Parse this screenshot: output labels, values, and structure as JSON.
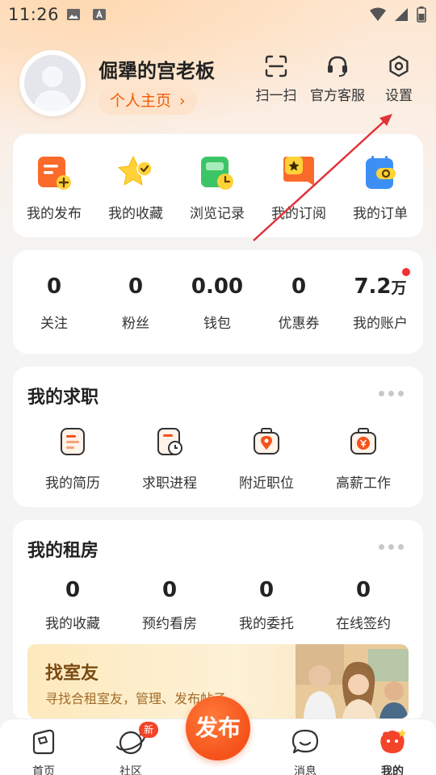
{
  "status_bar": {
    "time": "11:26"
  },
  "profile": {
    "name": "倔犟的宫老板",
    "homepage_label": "个人主页",
    "homepage_chevron": "›"
  },
  "top_actions": [
    {
      "label": "扫一扫",
      "icon": "scan-icon"
    },
    {
      "label": "官方客服",
      "icon": "headset-icon"
    },
    {
      "label": "设置",
      "icon": "settings-icon"
    }
  ],
  "quick_links": [
    {
      "label": "我的发布",
      "icon": "my-posts-icon"
    },
    {
      "label": "我的收藏",
      "icon": "star-icon"
    },
    {
      "label": "浏览记录",
      "icon": "history-icon"
    },
    {
      "label": "我的订阅",
      "icon": "subscription-icon"
    },
    {
      "label": "我的订单",
      "icon": "order-icon"
    }
  ],
  "stats": [
    {
      "value": "0",
      "label": "关注"
    },
    {
      "value": "0",
      "label": "粉丝"
    },
    {
      "value": "0.00",
      "label": "钱包"
    },
    {
      "value": "0",
      "label": "优惠券"
    },
    {
      "value": "7.2",
      "unit": "万",
      "label": "我的账户"
    }
  ],
  "job_section": {
    "title": "我的求职",
    "items": [
      {
        "label": "我的简历",
        "icon": "resume-icon"
      },
      {
        "label": "求职进程",
        "icon": "job-progress-icon"
      },
      {
        "label": "附近职位",
        "icon": "nearby-jobs-icon"
      },
      {
        "label": "高薪工作",
        "icon": "high-salary-icon"
      }
    ]
  },
  "rent_section": {
    "title": "我的租房",
    "items": [
      {
        "value": "0",
        "label": "我的收藏"
      },
      {
        "value": "0",
        "label": "预约看房"
      },
      {
        "value": "0",
        "label": "我的委托"
      },
      {
        "value": "0",
        "label": "在线签约"
      }
    ],
    "banner": {
      "title": "找室友",
      "subtitle": "寻找合租室友，管理、发布帖子"
    }
  },
  "bottom_nav": {
    "items": [
      {
        "label": "首页",
        "icon": "home-icon"
      },
      {
        "label": "社区",
        "icon": "community-icon",
        "badge": "新"
      },
      {
        "label": "消息",
        "icon": "message-icon"
      },
      {
        "label": "我的",
        "icon": "profile-icon"
      }
    ],
    "publish_label": "发布"
  },
  "colors": {
    "accent": "#f5521a",
    "annotation_arrow": "#e0333a"
  }
}
